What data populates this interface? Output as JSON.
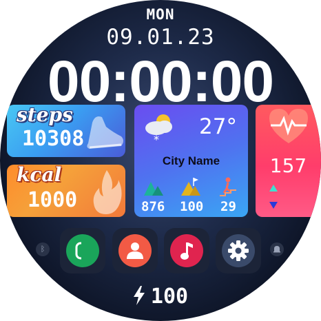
{
  "date_block": {
    "day": "MON",
    "date": "09.01.23"
  },
  "clock": {
    "time": "00:00:00"
  },
  "steps": {
    "label": "steps",
    "value": "10308",
    "icon": "sneaker-icon"
  },
  "kcal": {
    "label": "kcal",
    "value": "1000",
    "icon": "flame-icon"
  },
  "weather": {
    "icon": "cloudy-snow-icon",
    "temperature": "27°",
    "city": "City Name",
    "stats": [
      {
        "icon": "mountain-icon",
        "value": "876"
      },
      {
        "icon": "mountain-flag-icon",
        "value": "100"
      },
      {
        "icon": "stairs-climber-icon",
        "value": "29"
      }
    ]
  },
  "heart": {
    "icon": "heart-pulse-icon",
    "value": "157"
  },
  "apps": [
    {
      "name": "phone",
      "icon": "phone-icon",
      "color": "#1aa55a"
    },
    {
      "name": "contacts",
      "icon": "person-icon",
      "color": "#f25a45"
    },
    {
      "name": "music",
      "icon": "music-note-icon",
      "color": "#e0244f"
    },
    {
      "name": "settings",
      "icon": "gear-icon",
      "color": "#3a4a6a"
    }
  ],
  "side_indicators": {
    "left": "bluetooth-icon",
    "right": "bell-icon"
  },
  "battery": {
    "icon": "lightning-icon",
    "value": "100"
  },
  "colors": {
    "background": "#1e2b4a",
    "steps": "#3a9ef2",
    "kcal": "#f5a13a",
    "weather": "#5a6af0",
    "heart": "#ff4a64"
  }
}
